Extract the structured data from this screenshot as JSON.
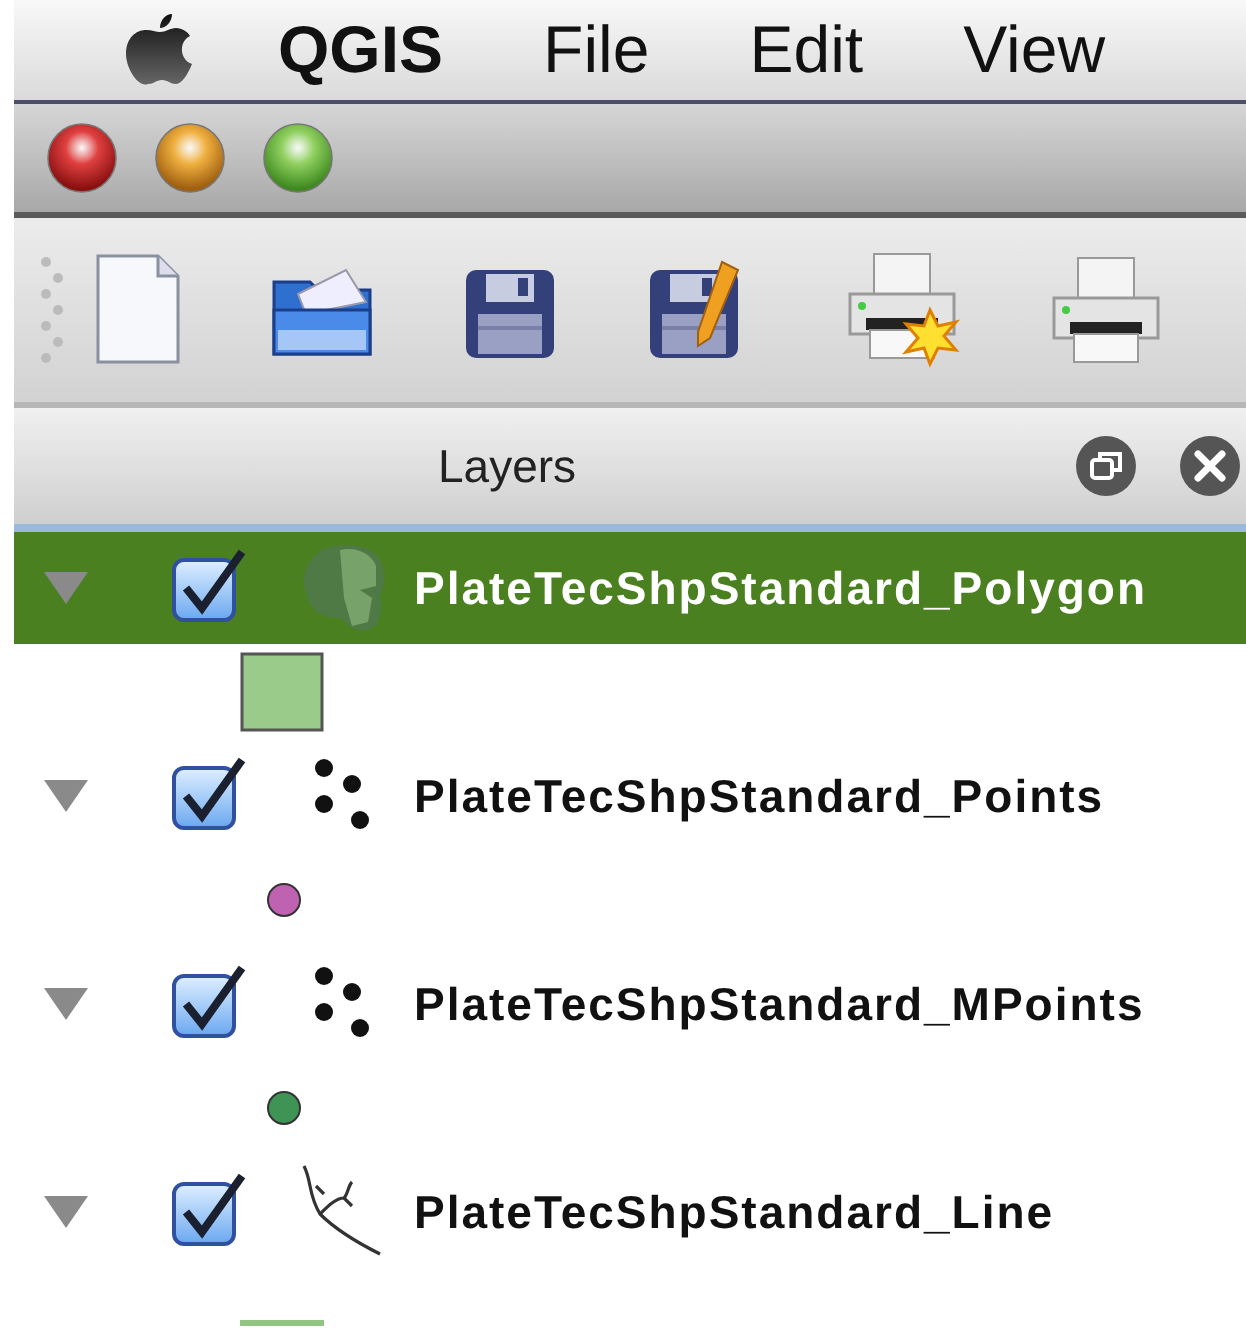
{
  "menu_bar": {
    "app_name": "QGIS",
    "items": [
      "File",
      "Edit",
      "View"
    ]
  },
  "layers_panel": {
    "title": "Layers",
    "layers": [
      {
        "kind": "polygon",
        "name": "PlateTecShpStandard_Polygon",
        "selected": true,
        "checked": true,
        "expanded": true,
        "color": "#9acb8a"
      },
      {
        "kind": "points",
        "name": "PlateTecShpStandard_Points",
        "selected": false,
        "checked": true,
        "expanded": true,
        "color": "#c062b2"
      },
      {
        "kind": "points",
        "name": "PlateTecShpStandard_MPoints",
        "selected": false,
        "checked": true,
        "expanded": true,
        "color": "#3f9455"
      },
      {
        "kind": "line",
        "name": "PlateTecShpStandard_Line",
        "selected": false,
        "checked": true,
        "expanded": true,
        "color": "#92c484"
      }
    ]
  }
}
